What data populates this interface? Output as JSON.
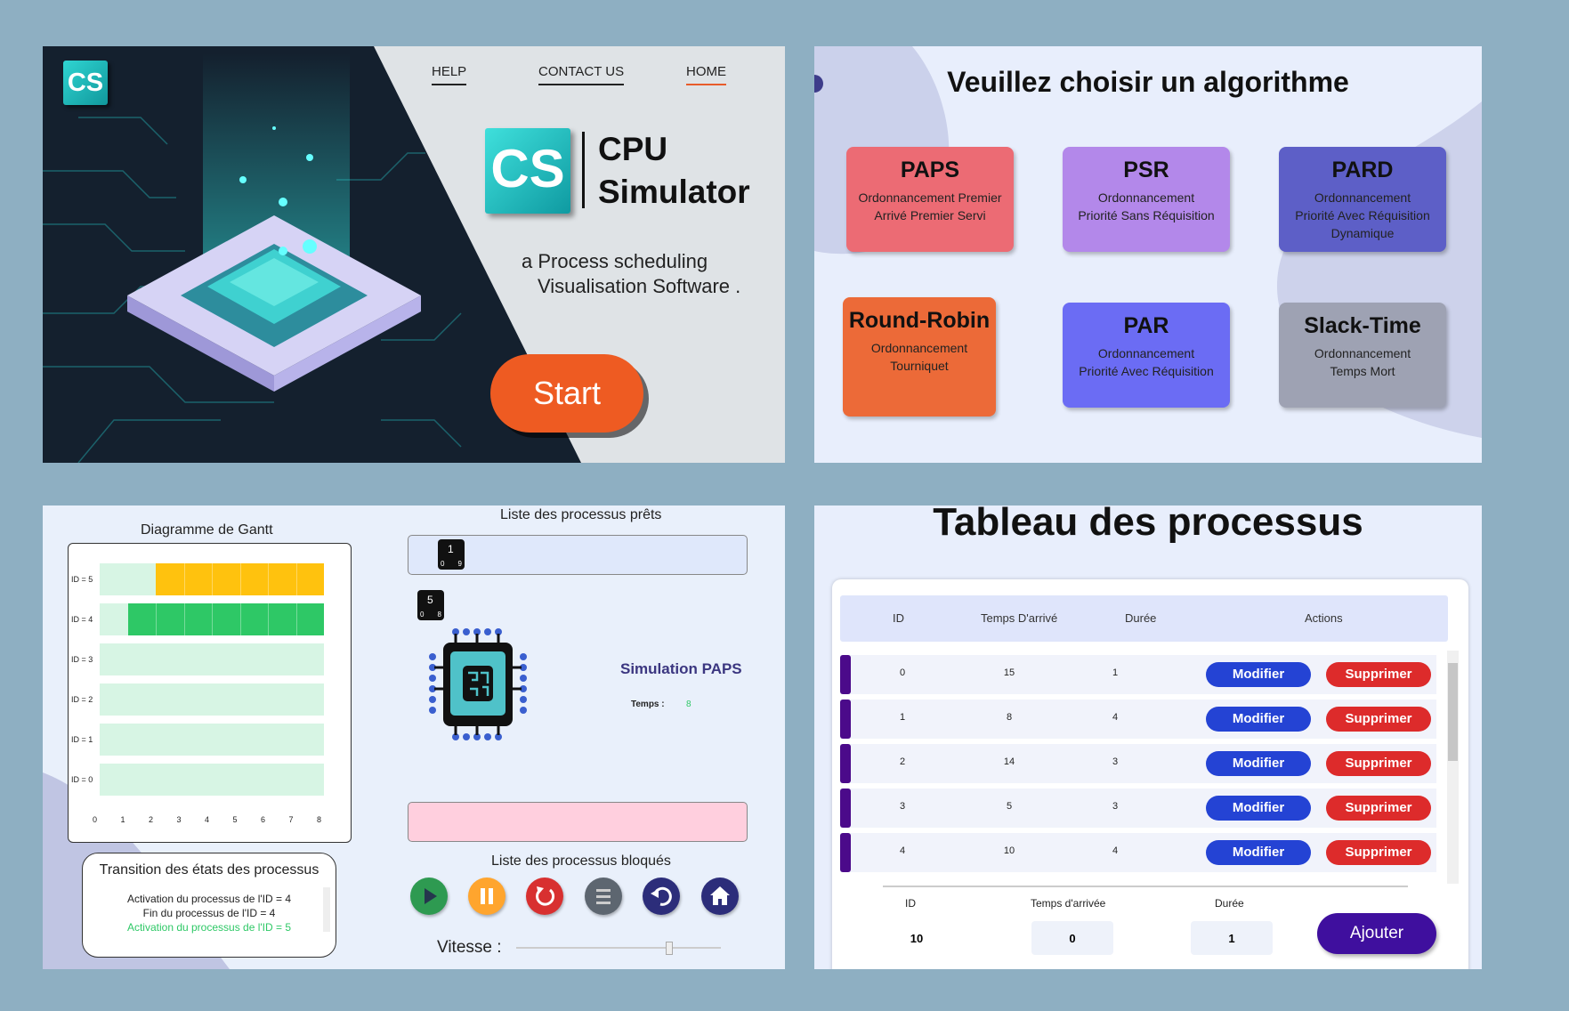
{
  "home": {
    "logo_small": "CS",
    "nav": {
      "help": "HELP",
      "contact": "CONTACT US",
      "home": "HOME"
    },
    "logo_big": "CS",
    "title_line1": "CPU",
    "title_line2": "Simulator",
    "subtitle_line1": "a Process scheduling",
    "subtitle_line2": "Visualisation Software .",
    "start": "Start",
    "colors": {
      "accent": "#ee5b22",
      "dark": "#14202e",
      "teal": "#2fd5d2"
    }
  },
  "algorithms": {
    "heading": "Veuillez choisir un algorithme",
    "cards": [
      {
        "title": "PAPS",
        "lines": [
          "Ordonnancement Premier",
          "Arrivé Premier Servi"
        ],
        "color": "#ec6b74"
      },
      {
        "title": "PSR",
        "lines": [
          "Ordonnancement",
          "Priorité Sans Réquisition"
        ],
        "color": "#b388ea"
      },
      {
        "title": "PARD",
        "lines": [
          "Ordonnancement",
          "Priorité Avec Réquisition",
          "Dynamique"
        ],
        "color": "#5d5fc7"
      },
      {
        "title": "Round-Robin",
        "lines": [
          "Ordonnancement",
          "Tourniquet"
        ],
        "color": "#ec6a38"
      },
      {
        "title": "PAR",
        "lines": [
          "Ordonnancement",
          "Priorité Avec Réquisition"
        ],
        "color": "#6b6cf4"
      },
      {
        "title": "Slack-Time",
        "lines": [
          "Ordonnancement",
          "Temps Mort"
        ],
        "color": "#9ea2b3"
      }
    ]
  },
  "simulation": {
    "gantt_title": "Diagramme de Gantt",
    "gantt_rows": [
      {
        "label": "ID = 5",
        "start": 2,
        "end": 8,
        "color": "#ffc20e"
      },
      {
        "label": "ID = 4",
        "start": 1,
        "end": 8,
        "color": "#2ec866"
      },
      {
        "label": "ID = 3"
      },
      {
        "label": "ID = 2"
      },
      {
        "label": "ID = 1"
      },
      {
        "label": "ID = 0"
      }
    ],
    "gantt_ticks": [
      "0",
      "1",
      "2",
      "3",
      "4",
      "5",
      "6",
      "7",
      "8"
    ],
    "gantt_max": 8,
    "transitions_title": "Transition des états des processus",
    "transitions": [
      {
        "text": "Activation du processus de l'ID = 4",
        "color": "#222222"
      },
      {
        "text": "Fin du processus de l'ID = 4",
        "color": "#222222"
      },
      {
        "text": "Activation du processus de l'ID = 5",
        "color": "#2ec866"
      }
    ],
    "ready_title": "Liste des processus prêts",
    "ready_process": {
      "id": "1",
      "arrival": "0",
      "duration": "9"
    },
    "running_process": {
      "id": "5",
      "arrival": "0",
      "duration": "8"
    },
    "sim_title": "Simulation PAPS",
    "time_label": "Temps :",
    "time_value": "8",
    "blocked_title": "Liste des processus bloqués",
    "speed_label": "Vitesse :",
    "speed_fraction": 0.73,
    "controls": [
      "play-icon",
      "pause-icon",
      "restart-icon",
      "list-icon",
      "back-icon",
      "home-icon"
    ]
  },
  "table": {
    "heading": "Tableau des processus",
    "headers": {
      "id": "ID",
      "arrival": "Temps D'arrivé",
      "duration": "Durée",
      "actions": "Actions"
    },
    "rows": [
      {
        "id": "0",
        "arrival": "15",
        "duration": "1"
      },
      {
        "id": "1",
        "arrival": "8",
        "duration": "4"
      },
      {
        "id": "2",
        "arrival": "14",
        "duration": "3"
      },
      {
        "id": "3",
        "arrival": "5",
        "duration": "3"
      },
      {
        "id": "4",
        "arrival": "10",
        "duration": "4"
      }
    ],
    "modify": "Modifier",
    "delete": "Supprimer",
    "form": {
      "id_label": "ID",
      "id_value": "10",
      "arrival_label": "Temps d'arrivée",
      "arrival_value": "0",
      "duration_label": "Durée",
      "duration_value": "1"
    },
    "add": "Ajouter"
  }
}
